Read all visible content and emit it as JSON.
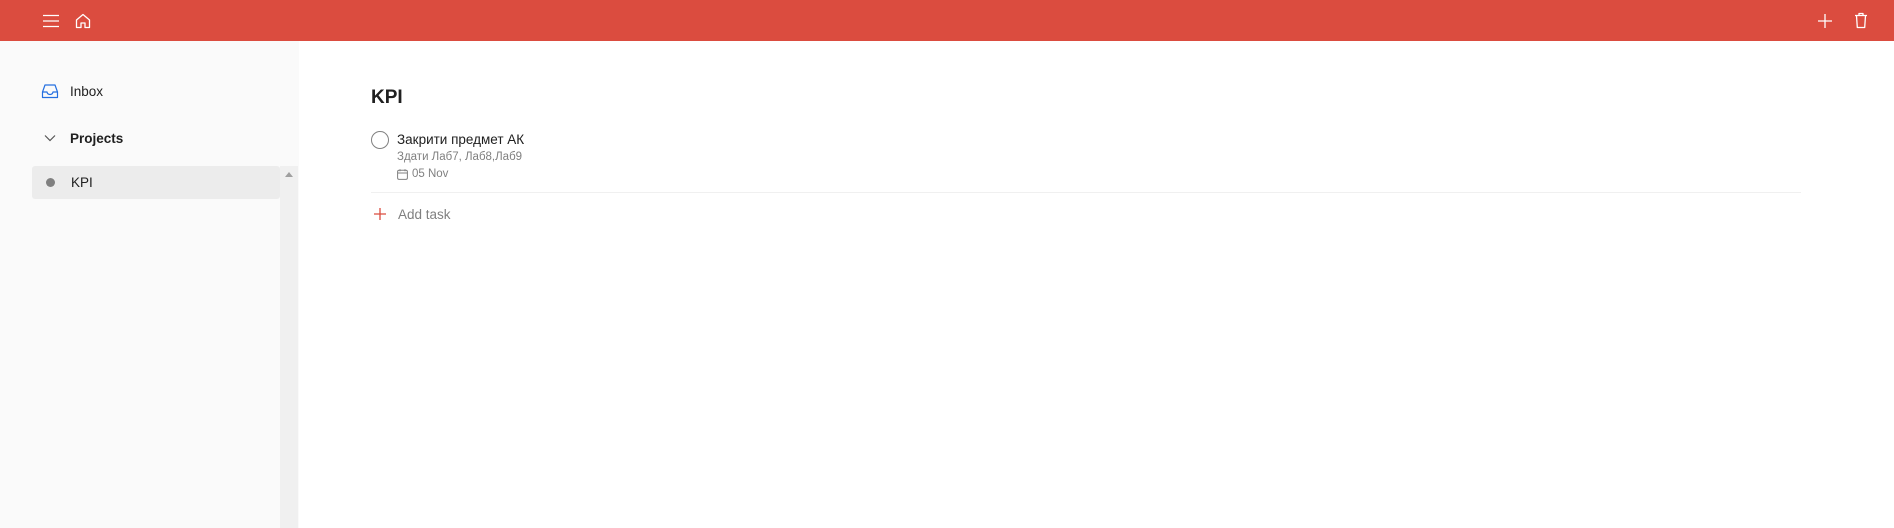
{
  "colors": {
    "topbar": "#db4c3f",
    "accent": "#db4c3f",
    "project_dot": "#808080"
  },
  "topbar": {
    "menu_icon": "hamburger-menu-icon",
    "home_icon": "home-icon",
    "add_icon": "plus-icon",
    "delete_icon": "trash-icon"
  },
  "sidebar": {
    "inbox": {
      "label": "Inbox",
      "icon": "inbox-icon"
    },
    "projects": {
      "label": "Projects",
      "icon": "chevron-down-icon"
    },
    "project_items": [
      {
        "label": "KPI"
      }
    ]
  },
  "main": {
    "title": "KPI",
    "tasks": [
      {
        "title": "Закрити предмет АК",
        "description": "Здати Лаб7, Лаб8,Лаб9",
        "due": "05 Nov"
      }
    ],
    "add_task_label": "Add task"
  }
}
